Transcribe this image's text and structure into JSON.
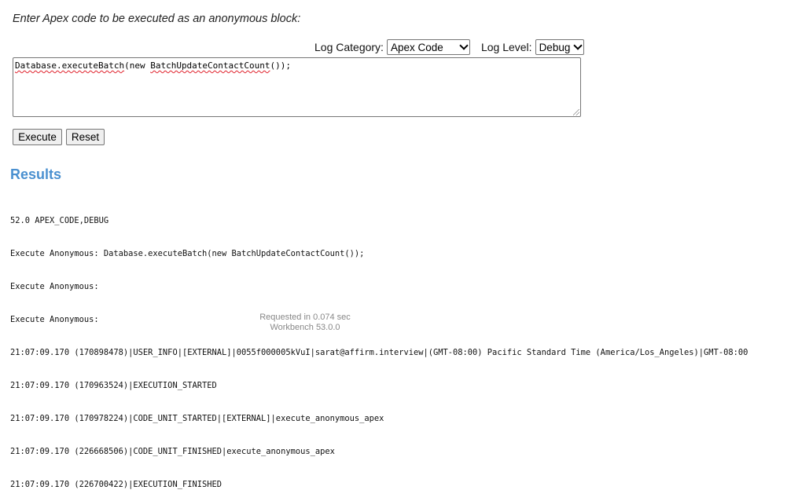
{
  "prompt": "Enter Apex code to be executed as an anonymous block:",
  "log": {
    "category_label": "Log Category:",
    "category_value": "Apex Code",
    "level_label": "Log Level:",
    "level_value": "Debug"
  },
  "code": {
    "part1": "Database.executeBatch",
    "part2": "(new ",
    "part3": "BatchUpdateContactCount",
    "part4": "());"
  },
  "buttons": {
    "execute": "Execute",
    "reset": "Reset"
  },
  "results": {
    "title": "Results",
    "lines": [
      "52.0 APEX_CODE,DEBUG",
      "Execute Anonymous: Database.executeBatch(new BatchUpdateContactCount());",
      "Execute Anonymous:",
      "Execute Anonymous:",
      "21:07:09.170 (170898478)|USER_INFO|[EXTERNAL]|0055f000005kVuI|sarat@affirm.interview|(GMT-08:00) Pacific Standard Time (America/Los_Angeles)|GMT-08:00",
      "21:07:09.170 (170963524)|EXECUTION_STARTED",
      "21:07:09.170 (170978224)|CODE_UNIT_STARTED|[EXTERNAL]|execute_anonymous_apex",
      "21:07:09.170 (226668506)|CODE_UNIT_FINISHED|execute_anonymous_apex",
      "21:07:09.170 (226700422)|EXECUTION_FINISHED"
    ]
  },
  "footer": {
    "requested": "Requested in 0.074 sec",
    "version": "Workbench 53.0.0"
  }
}
